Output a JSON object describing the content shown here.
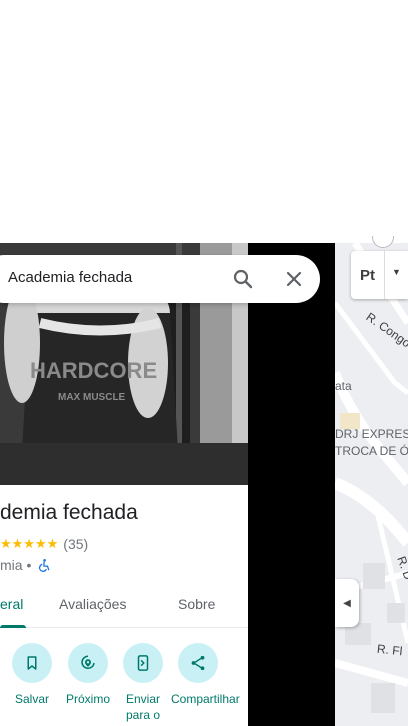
{
  "search": {
    "query": "Academia fechada"
  },
  "place": {
    "name_visible": "demia fechada",
    "stars": "★★★★★",
    "rating_count": "(35)",
    "category_visible": "mia •"
  },
  "tabs": [
    {
      "label": "eral",
      "active": true
    },
    {
      "label": "Avaliações",
      "active": false
    },
    {
      "label": "Sobre",
      "active": false
    }
  ],
  "actions": [
    {
      "label": "Salvar",
      "icon": "bookmark-icon"
    },
    {
      "label": "Próximo",
      "icon": "nearby-icon"
    },
    {
      "label": "Enviar para o",
      "icon": "send-to-phone-icon"
    },
    {
      "label": "Compartilhar",
      "icon": "share-icon"
    }
  ],
  "map": {
    "layer_button": "Pt",
    "labels": [
      {
        "text": "R. Congo"
      },
      {
        "text": "ata"
      },
      {
        "text": "DRJ EXPRES"
      },
      {
        "text": "TROCA DE Ó"
      },
      {
        "text": "R. D"
      },
      {
        "text": "R. Fl"
      }
    ]
  },
  "photo": {
    "shirt_text_line1": "HARDCORE",
    "shirt_text_line2": "MAX MUSCLE"
  },
  "colors": {
    "accent": "#00796b",
    "action_circle": "#c8f0f5",
    "star": "#fbbc04",
    "access_icon": "#1a73e8"
  }
}
